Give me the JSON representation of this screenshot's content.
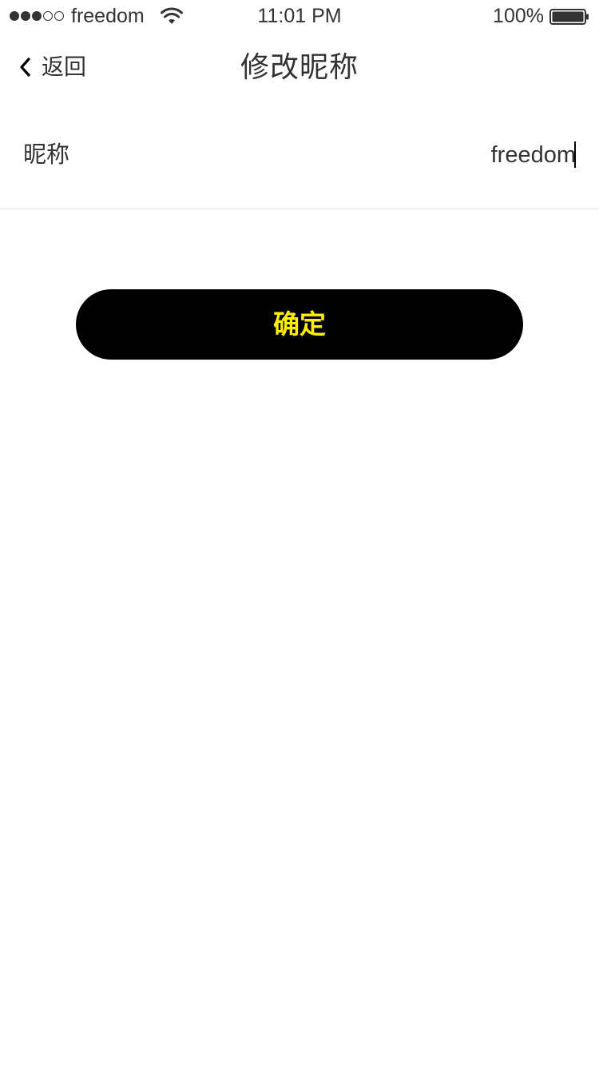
{
  "status_bar": {
    "signal_filled": 3,
    "signal_total": 5,
    "carrier": "freedom",
    "wifi_icon": "wifi-icon",
    "time": "11:01 PM",
    "battery_percent": "100%",
    "battery_icon": "battery-full-icon"
  },
  "nav": {
    "back_icon": "chevron-left-icon",
    "back_label": "返回",
    "title": "修改昵称"
  },
  "form": {
    "nickname_label": "昵称",
    "nickname_value": "freedom"
  },
  "confirm_button": {
    "label": "确定",
    "background": "#000000",
    "text_color": "#ffee00"
  }
}
